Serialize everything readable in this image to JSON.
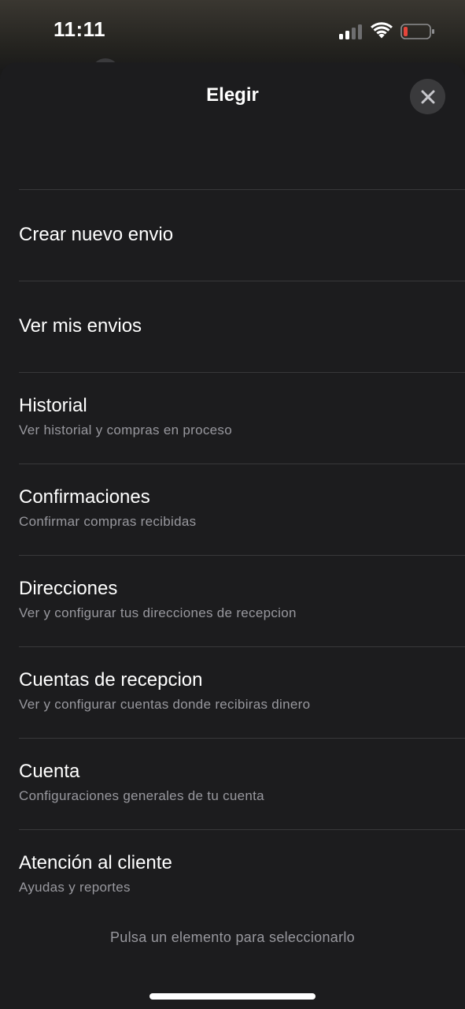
{
  "status_bar": {
    "time": "11:11",
    "battery_color": "#e5453a"
  },
  "sheet": {
    "title": "Elegir",
    "close_icon": "close-icon"
  },
  "menu": {
    "items": [
      {
        "title": "Crear nuevo envio",
        "subtitle": ""
      },
      {
        "title": "Ver mis envios",
        "subtitle": ""
      },
      {
        "title": "Historial",
        "subtitle": "Ver historial y compras en proceso"
      },
      {
        "title": "Confirmaciones",
        "subtitle": "Confirmar compras recibidas"
      },
      {
        "title": "Direcciones",
        "subtitle": "Ver y configurar tus direcciones de recepcion"
      },
      {
        "title": "Cuentas de recepcion",
        "subtitle": "Ver y configurar cuentas donde recibiras dinero"
      },
      {
        "title": "Cuenta",
        "subtitle": "Configuraciones generales de tu cuenta"
      },
      {
        "title": "Atención al cliente",
        "subtitle": "Ayudas y reportes"
      }
    ]
  },
  "footer": {
    "hint": "Pulsa un elemento para seleccionarlo"
  }
}
